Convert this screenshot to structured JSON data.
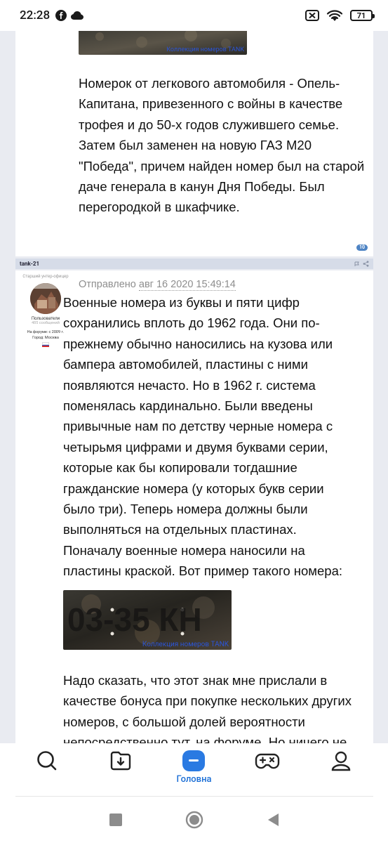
{
  "status_bar": {
    "time": "22:28",
    "left_icons": [
      "facebook-icon",
      "cloud-icon"
    ],
    "right_icons": [
      "no-sim-icon",
      "wifi-icon"
    ],
    "battery": "71"
  },
  "posts": [
    {
      "image_caption": "Коллекция номеров TANK",
      "text": "Номерок от легкового автомобиля - Опель-Капитана, привезенного с войны в качестве трофея и до 50-х годов служившего семье. Затем был заменен на новую ГАЗ М20 \"Победа\", причем найден номер был на старой даче генерала в канун Дня Победы. Был перегородкой в шкафчике.",
      "like_count": "10"
    },
    {
      "author": "tank-21",
      "author_role": "Старший унтер-офицер",
      "author_group": "Пользователи",
      "author_posts": "485 сообщений",
      "author_joined": "На форуме: с 2009 г.",
      "author_city": "Город: Москва",
      "posted_label": "Отправлено",
      "posted_date": "авг 16 2020 15:49:14",
      "text": "Военные номера из буквы и пяти цифр сохранились вплоть до 1962 года. Они по-прежнему обычно наносились на кузова или бампера автомобилей, пластины с ними появляются нечасто. Но в 1962 г. система поменялась кардинально. Были введены привычные нам по детству черные номера с четырьмя цифрами и двумя буквами серии, которые как бы копировали тогдашние гражданские номера (у которых букв серии было три). Теперь номера должны были выполняться на отдельных пластинах. Поначалу военные номера наносили на пластины краской. Вот пример такого номера:",
      "image_caption": "Коллекция номеров TANK",
      "plate_text": "03-35 КН",
      "text_after": "Надо сказать, что этот знак мне прислали в качестве бонуса при покупке нескольких других номеров, с большой долей вероятности непосредственно тут, на форуме. Но ничего не"
    }
  ],
  "bottom_nav": {
    "items": [
      {
        "name": "search",
        "label": ""
      },
      {
        "name": "downloads",
        "label": ""
      },
      {
        "name": "home",
        "label": "Головна"
      },
      {
        "name": "games",
        "label": ""
      },
      {
        "name": "profile",
        "label": ""
      }
    ],
    "accent": "#2a7ae2"
  },
  "system_nav": [
    "recents",
    "home",
    "back"
  ]
}
